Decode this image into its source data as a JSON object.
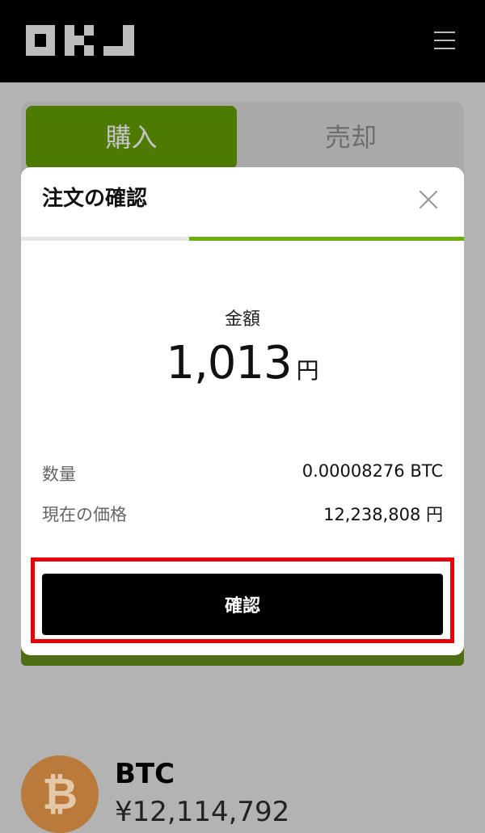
{
  "header": {
    "logo_text": "OKJ",
    "menu_icon": "hamburger-menu-icon"
  },
  "tabs": {
    "buy_label": "購入",
    "sell_label": "売却",
    "active": "buy"
  },
  "modal": {
    "title": "注文の確認",
    "close_icon": "close-icon",
    "progress_fraction": 0.62,
    "amount_label": "金額",
    "amount_value": "1,013",
    "amount_unit": "円",
    "details": [
      {
        "label": "数量",
        "value": "0.00008276 BTC"
      },
      {
        "label": "現在の価格",
        "value": "12,238,808 円"
      }
    ],
    "confirm_label": "確認"
  },
  "asset": {
    "symbol": "BTC",
    "icon": "bitcoin-icon",
    "price_text": "¥12,114,792"
  },
  "colors": {
    "accent_green": "#4d7a00",
    "progress_green": "#6dad0e",
    "highlight_red": "#e8000b",
    "bitcoin_orange": "#b97a3c"
  }
}
